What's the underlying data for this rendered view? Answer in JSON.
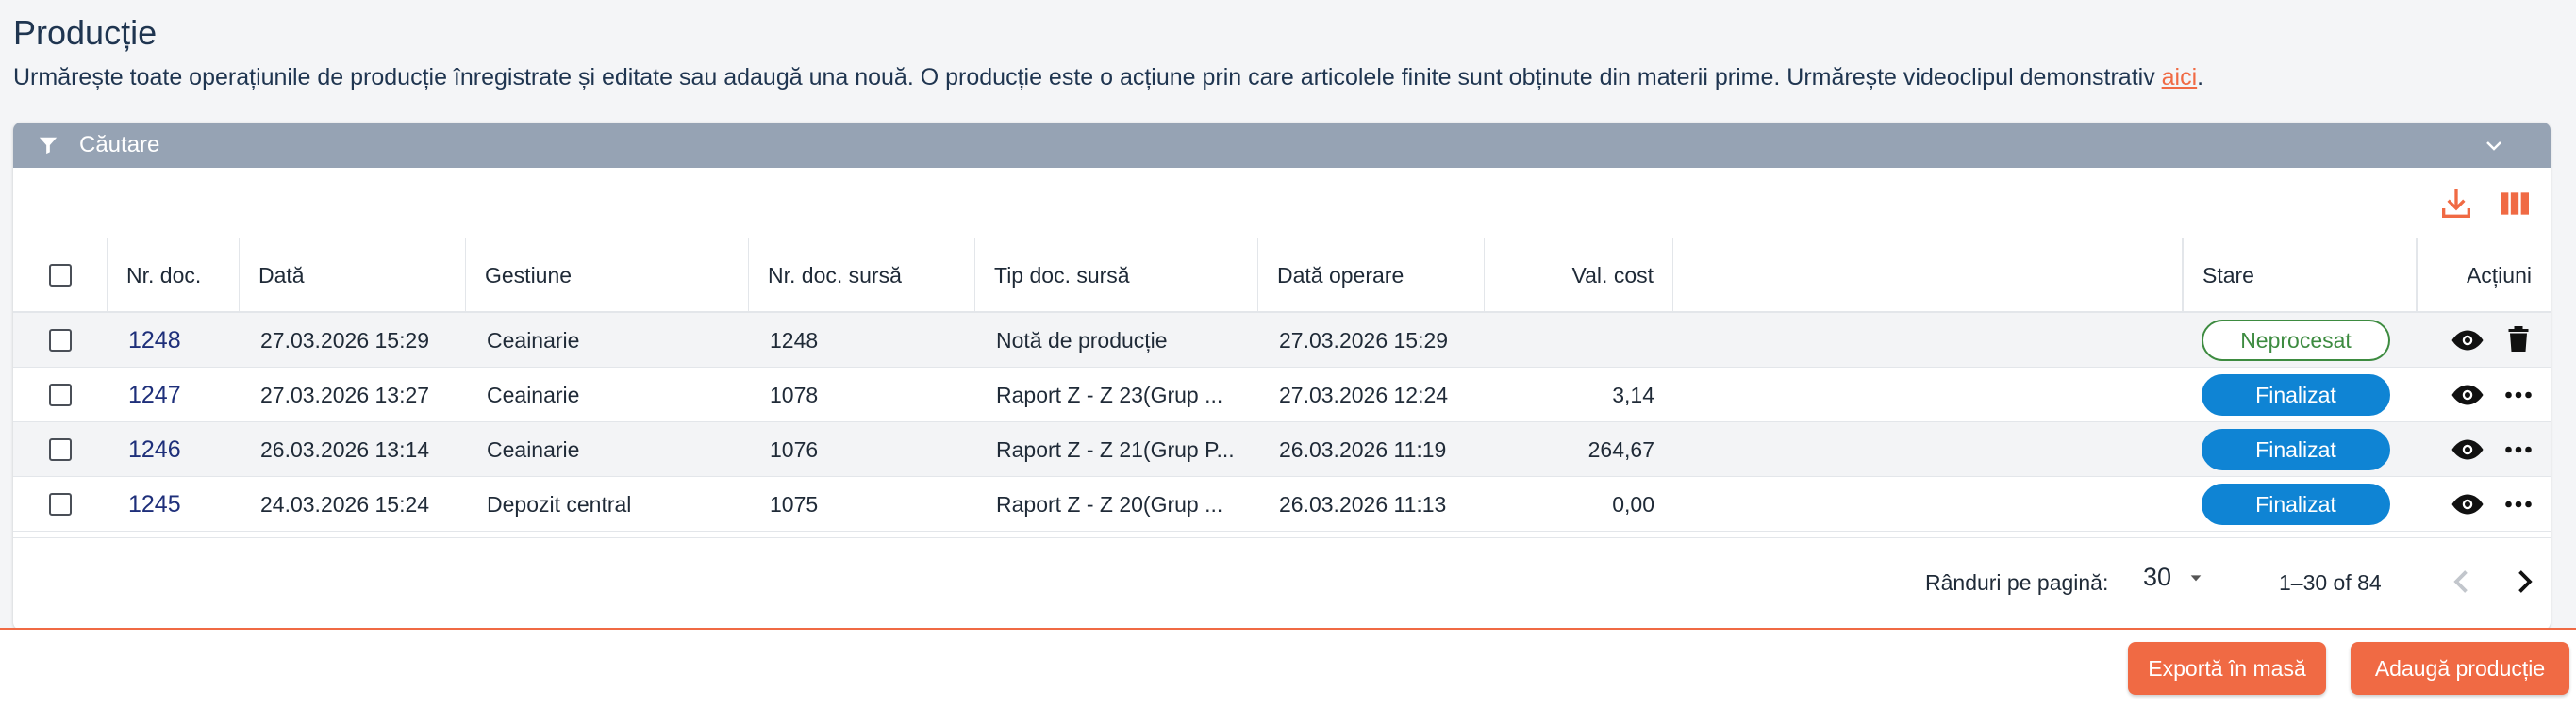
{
  "page": {
    "title": "Producție",
    "description": "Urmărește toate operațiunile de producție înregistrate și editate sau adaugă una nouă. O producție este o acțiune prin care articolele finite sunt obținute din materii prime. Urmărește videoclipul demonstrativ ",
    "description_link": "aici",
    "description_end": "."
  },
  "search": {
    "label": "Căutare"
  },
  "table": {
    "columns": {
      "nr_doc": "Nr. doc.",
      "data": "Dată",
      "gestiune": "Gestiune",
      "nr_doc_sursa": "Nr. doc. sursă",
      "tip_doc_sursa": "Tip doc. sursă",
      "data_operare": "Dată operare",
      "val_cost": "Val. cost",
      "stare": "Stare",
      "actiuni": "Acțiuni"
    },
    "rows": [
      {
        "nr_doc": "1248",
        "data": "27.03.2026 15:29",
        "gestiune": "Ceainarie",
        "nr_doc_sursa": "1248",
        "tip_doc_sursa": "Notă de producție",
        "data_operare": "27.03.2026 15:29",
        "val_cost": "",
        "stare": "Neprocesat"
      },
      {
        "nr_doc": "1247",
        "data": "27.03.2026 13:27",
        "gestiune": "Ceainarie",
        "nr_doc_sursa": "1078",
        "tip_doc_sursa": "Raport Z - Z 23(Grup ...",
        "data_operare": "27.03.2026 12:24",
        "val_cost": "3,14",
        "stare": "Finalizat"
      },
      {
        "nr_doc": "1246",
        "data": "26.03.2026 13:14",
        "gestiune": "Ceainarie",
        "nr_doc_sursa": "1076",
        "tip_doc_sursa": "Raport Z - Z 21(Grup P...",
        "data_operare": "26.03.2026 11:19",
        "val_cost": "264,67",
        "stare": "Finalizat"
      },
      {
        "nr_doc": "1245",
        "data": "24.03.2026 15:24",
        "gestiune": "Depozit central",
        "nr_doc_sursa": "1075",
        "tip_doc_sursa": "Raport Z - Z 20(Grup ...",
        "data_operare": "26.03.2026 11:13",
        "val_cost": "0,00",
        "stare": "Finalizat"
      }
    ]
  },
  "pagination": {
    "rows_per_page_label": "Rânduri pe pagină:",
    "rows_per_page": "30",
    "range": "1–30 of 84"
  },
  "buttons": {
    "export": "Exportă în masă",
    "add": "Adaugă producție"
  },
  "colors": {
    "accent": "#f06a44",
    "final": "#0f84d4",
    "neprocesat": "#3d8b40",
    "search_bar": "#96a3b4"
  }
}
